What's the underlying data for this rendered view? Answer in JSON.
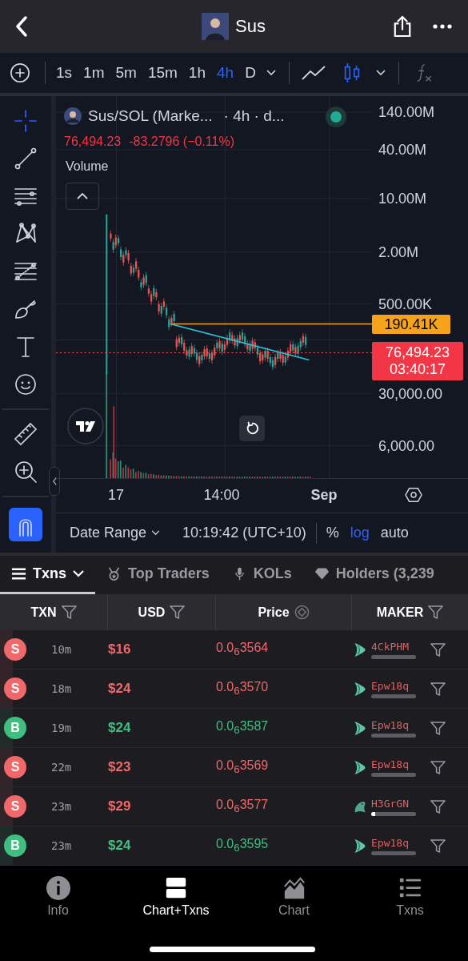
{
  "header": {
    "title": "Sus"
  },
  "intervals": [
    {
      "label": "1s",
      "selected": false
    },
    {
      "label": "1m",
      "selected": false
    },
    {
      "label": "5m",
      "selected": false
    },
    {
      "label": "15m",
      "selected": false
    },
    {
      "label": "1h",
      "selected": false
    },
    {
      "label": "4h",
      "selected": true
    },
    {
      "label": "D",
      "selected": false
    }
  ],
  "chart_types": [
    {
      "kind": "line",
      "selected": false
    },
    {
      "kind": "candles",
      "selected": true
    }
  ],
  "drawing_tools": [
    {
      "kind": "crosshair",
      "selected": true
    },
    {
      "kind": "trend-line",
      "selected": false
    },
    {
      "kind": "parallel-lines",
      "selected": false
    },
    {
      "kind": "pattern",
      "selected": false
    },
    {
      "kind": "fib",
      "selected": false
    },
    {
      "kind": "brush",
      "selected": false
    },
    {
      "kind": "text",
      "selected": false
    },
    {
      "kind": "emoji",
      "selected": false
    },
    {
      "kind": "ruler",
      "selected": false
    },
    {
      "kind": "zoom",
      "selected": false
    },
    {
      "kind": "magnet",
      "selected": true
    }
  ],
  "legend": {
    "symbol": "Sus/SOL (Marke...",
    "interval": "· 4h · d...",
    "last": "76,494.23",
    "change": "-83.2796 (−0.11%)",
    "indicator": "Volume"
  },
  "price_axis": [
    "140.00M",
    "40.00M",
    "10.00M",
    "2.00M",
    "500.00K",
    "30,000.00",
    "6,000.00"
  ],
  "price_tags": [
    {
      "kind": "alert",
      "label": "190.41K"
    },
    {
      "kind": "last",
      "label": "76,494.23",
      "timer": "03:40:17"
    }
  ],
  "time_axis": [
    {
      "label": "17",
      "kind": "day"
    },
    {
      "label": "14:00",
      "kind": "time"
    },
    {
      "label": "Sep",
      "kind": "month"
    }
  ],
  "footer": {
    "date_range": "Date Range",
    "clock": "10:19:42 (UTC+10)",
    "percent": "%",
    "log": {
      "label": "log",
      "on": true
    },
    "auto": {
      "label": "auto",
      "on": false
    }
  },
  "tabs": [
    {
      "label": "Txns",
      "kind": "menu",
      "selected": true
    },
    {
      "label": "Top Traders",
      "kind": "medal",
      "selected": false
    },
    {
      "label": "KOLs",
      "kind": "mic",
      "selected": false
    },
    {
      "label": "Holders (3,239",
      "kind": "diamond",
      "selected": false
    }
  ],
  "table": {
    "columns": [
      {
        "label": "TXN",
        "kind": "filter"
      },
      {
        "label": "USD",
        "kind": "filter"
      },
      {
        "label": "Price",
        "kind": "toggle"
      },
      {
        "label": "MAKER",
        "kind": "filter"
      }
    ],
    "rows": [
      {
        "kind": "sell",
        "badge": "S",
        "age": "10m",
        "usd": "$16",
        "price": "0.0$_{6}$3564",
        "maker": {
          "kind": "fin",
          "name": "4CkPHM",
          "level": 0
        }
      },
      {
        "kind": "sell",
        "badge": "S",
        "age": "18m",
        "usd": "$24",
        "price": "0.0$_{6}$3570",
        "maker": {
          "kind": "fin",
          "name": "Epw18q",
          "level": 0
        }
      },
      {
        "kind": "buy",
        "badge": "B",
        "age": "19m",
        "usd": "$24",
        "price": "0.0$_{6}$3587",
        "maker": {
          "kind": "fin",
          "name": "Epw18q",
          "level": 0
        }
      },
      {
        "kind": "sell",
        "badge": "S",
        "age": "22m",
        "usd": "$23",
        "price": "0.0$_{6}$3569",
        "maker": {
          "kind": "fin",
          "name": "Epw18q",
          "level": 0
        }
      },
      {
        "kind": "sell",
        "badge": "S",
        "age": "23m",
        "usd": "$29",
        "price": "0.0$_{6}$3577",
        "maker": {
          "kind": "whale",
          "name": "H3GrGN",
          "level": 0.09
        }
      },
      {
        "kind": "buy",
        "badge": "B",
        "age": "23m",
        "usd": "$24",
        "price": "0.0$_{6}$3595",
        "maker": {
          "kind": "fin",
          "name": "Epw18q",
          "level": 0
        }
      }
    ]
  },
  "nav": [
    {
      "label": "Info",
      "kind": "info",
      "selected": false
    },
    {
      "label": "Chart+Txns",
      "kind": "split",
      "selected": true
    },
    {
      "label": "Chart",
      "kind": "chart",
      "selected": false
    },
    {
      "label": "Txns",
      "kind": "list",
      "selected": false
    }
  ]
}
